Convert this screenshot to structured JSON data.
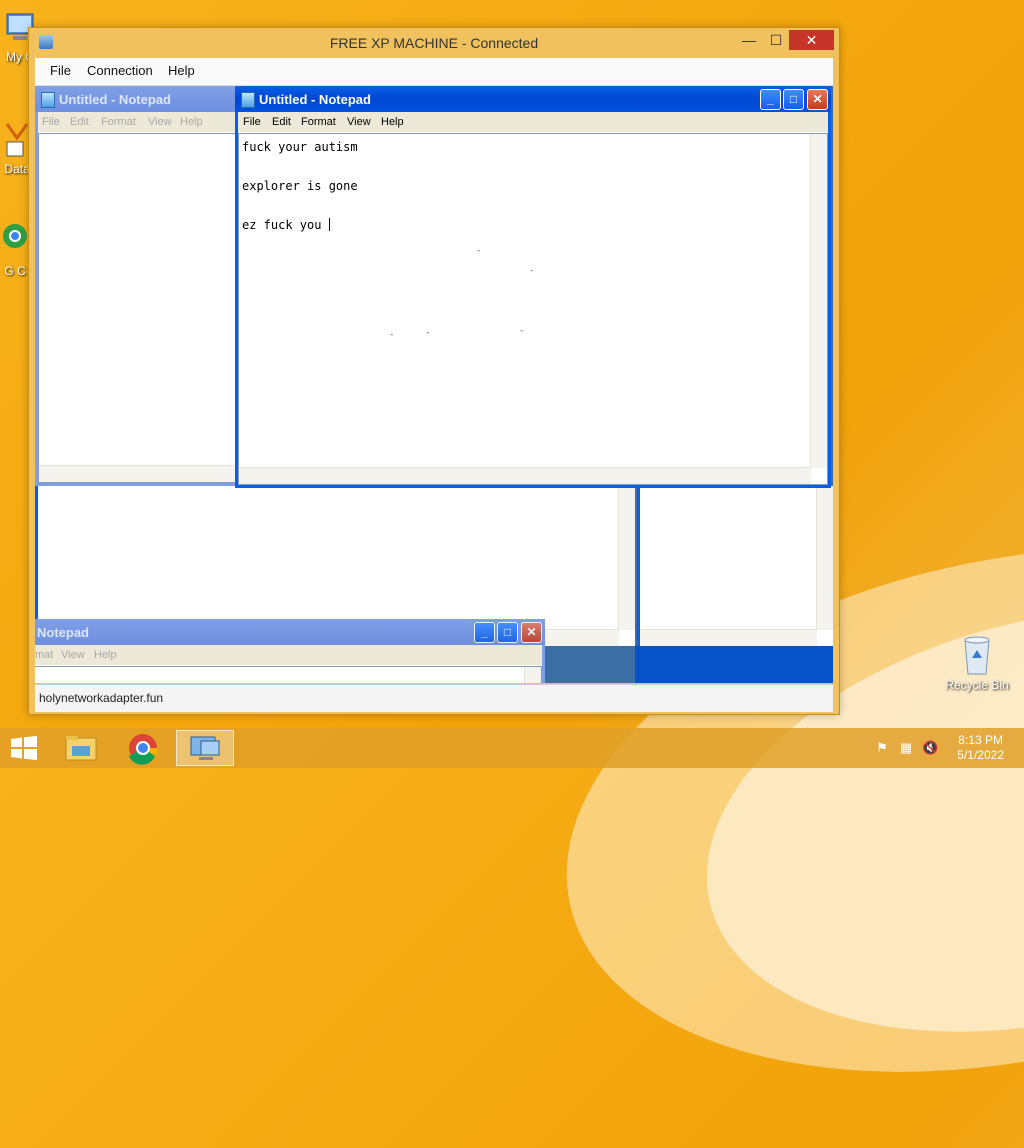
{
  "desktop": {
    "icons": [
      {
        "label": "My C",
        "icon": "computer-icon"
      },
      {
        "label": "Data",
        "icon": "folder-shortcut-icon"
      },
      {
        "label": "G C",
        "icon": "chrome-shortcut-icon"
      },
      {
        "label": "Recycle Bin",
        "icon": "recycle-bin-icon"
      }
    ]
  },
  "host_window": {
    "title": "FREE XP MACHINE - Connected",
    "min_glyph": "—",
    "max_glyph": "☐",
    "close_glyph": "✕",
    "menu": [
      "File",
      "Connection",
      "Help"
    ],
    "status_text": "holynetworkadapter.fun"
  },
  "notepad_main": {
    "title": "Untitled - Notepad",
    "menu": [
      "File",
      "Edit",
      "Format",
      "View",
      "Help"
    ],
    "lines": [
      "fuck your autism",
      "",
      "explorer is gone",
      "",
      "ez fuck you "
    ],
    "buttons": {
      "min": "_",
      "max": "□",
      "close": "✕"
    }
  },
  "notepad_back": {
    "title": "Untitled - Notepad",
    "menu": [
      "File",
      "Edit",
      "Format",
      "View",
      "Help"
    ]
  },
  "notepad_bottom": {
    "title": "Notepad",
    "menu": [
      "mat",
      "View",
      "Help"
    ]
  },
  "taskbar": {
    "apps": [
      "start-icon",
      "file-explorer-icon",
      "chrome-icon",
      "remote-desktop-icon"
    ],
    "time": "8:13 PM",
    "date": "5/1/2022"
  },
  "colors": {
    "xp_blue": "#0a5fe8",
    "desktop": "#f4a80f",
    "host_close": "#c7352a"
  }
}
